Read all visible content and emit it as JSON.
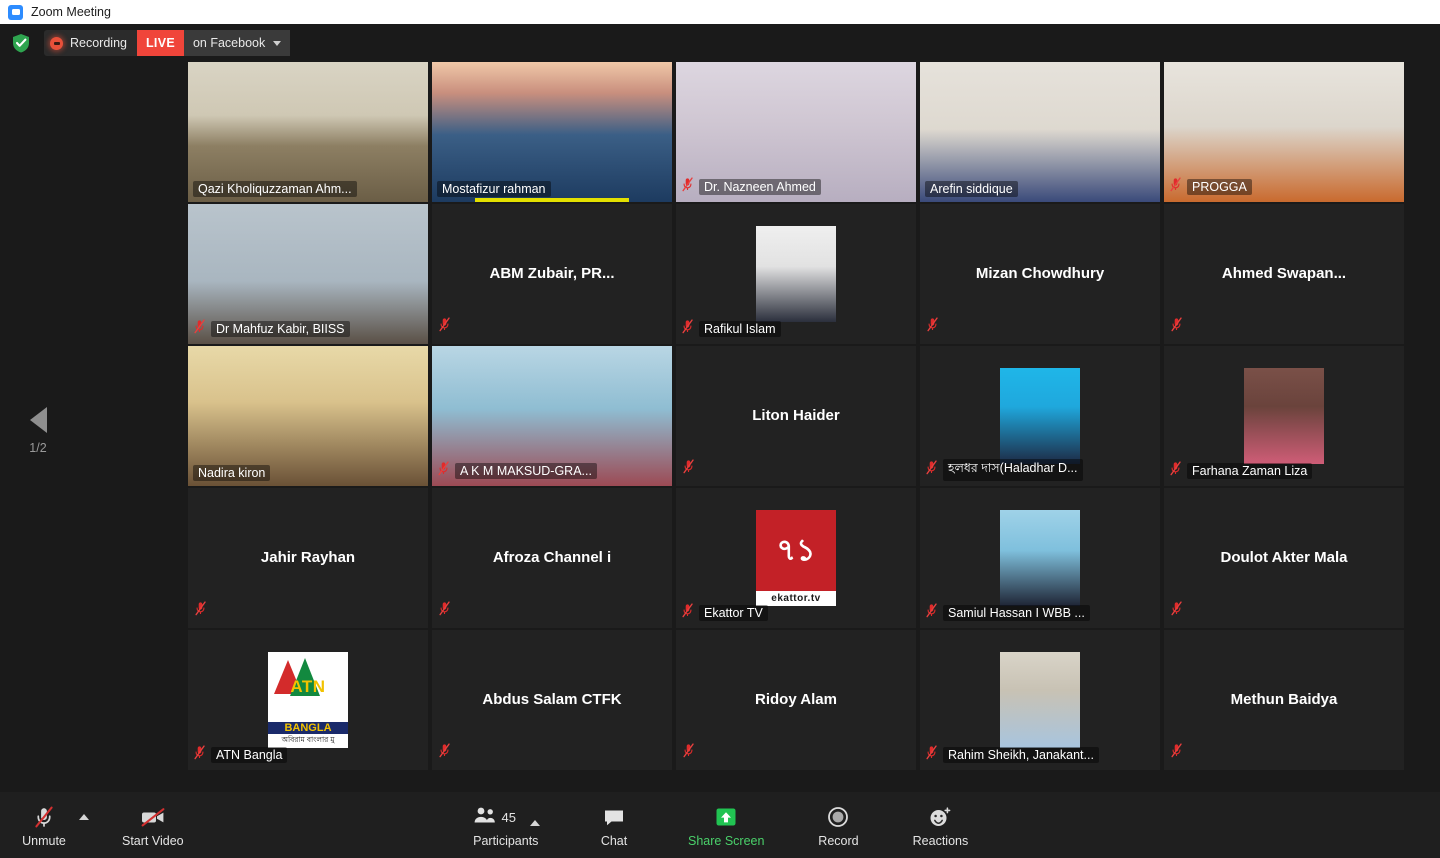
{
  "window": {
    "title": "Zoom Meeting",
    "app_icon": "zoom-video-icon"
  },
  "status_bar": {
    "shield_icon": "encryption-shield-icon",
    "recording_icon": "recording-dot-icon",
    "recording_label": "Recording",
    "live_badge": "LIVE",
    "live_target": "on Facebook",
    "live_dropdown_icon": "chevron-down-icon"
  },
  "page_nav": {
    "prev_icon": "chevron-left-icon",
    "page_indicator": "1/2"
  },
  "colors": {
    "active_speaker": "#e3e000",
    "live_red": "#f0453a",
    "share_green": "#4ad06a",
    "mute_red": "#e02b2b",
    "tile_bg": "#222222"
  },
  "gallery": {
    "rows": [
      [
        {
          "name": "Qazi Kholiquzzaman Ahm...",
          "display": "strip",
          "video": true,
          "muted": false,
          "active": false,
          "speaking": false,
          "media": "video-bookshelf"
        },
        {
          "name": "Mostafizur rahman",
          "display": "strip",
          "video": true,
          "muted": false,
          "active": false,
          "speaking": true,
          "media": "video-sunset"
        },
        {
          "name": "Dr. Nazneen Ahmed",
          "display": "strip",
          "video": true,
          "muted": true,
          "active": false,
          "speaking": false,
          "media": "video-curtain"
        },
        {
          "name": "Arefin siddique",
          "display": "strip",
          "video": true,
          "muted": false,
          "active": true,
          "speaking": false,
          "media": "video-wall-portrait"
        },
        {
          "name": "PROGGA",
          "display": "strip",
          "video": true,
          "muted": true,
          "active": false,
          "speaking": false,
          "media": "video-orange-shirt"
        }
      ],
      [
        {
          "name": "Dr Mahfuz Kabir, BIISS",
          "display": "strip",
          "video": true,
          "muted": true,
          "active": false,
          "speaking": false,
          "media": "video-striped-curtain"
        },
        {
          "name": "ABM  Zubair,  PR...",
          "display": "center",
          "video": false,
          "muted": true,
          "active": false,
          "speaking": false
        },
        {
          "name": "Rafikul Islam",
          "display": "strip",
          "video": false,
          "photo": true,
          "muted": true,
          "active": false,
          "speaking": false,
          "media": "photo-suit-young-man"
        },
        {
          "name": "Mizan Chowdhury",
          "display": "center",
          "video": false,
          "muted": true,
          "active": false,
          "speaking": false
        },
        {
          "name": "Ahmed  Swapan...",
          "display": "center",
          "video": false,
          "muted": true,
          "active": false,
          "speaking": false
        }
      ],
      [
        {
          "name": "Nadira kiron",
          "display": "strip",
          "video": true,
          "muted": false,
          "active": false,
          "speaking": false,
          "media": "video-woman-glasses"
        },
        {
          "name": "A K M MAKSUD-GRA...",
          "display": "strip",
          "video": true,
          "muted": true,
          "active": false,
          "speaking": false,
          "media": "video-blue-curtain-man"
        },
        {
          "name": "Liton Haider",
          "display": "center",
          "video": false,
          "muted": true,
          "active": false,
          "speaking": false
        },
        {
          "name": "হলধর দাস(Haladhar D...",
          "display": "strip",
          "video": false,
          "photo": true,
          "muted": true,
          "active": false,
          "speaking": false,
          "media": "photo-blue-bg-man"
        },
        {
          "name": "Farhana Zaman Liza",
          "display": "strip",
          "video": false,
          "photo": true,
          "muted": true,
          "active": false,
          "speaking": false,
          "media": "photo-woman-pink"
        }
      ],
      [
        {
          "name": "Jahir Rayhan",
          "display": "center",
          "video": false,
          "muted": true,
          "active": false,
          "speaking": false
        },
        {
          "name": "Afroza Channel i",
          "display": "center",
          "video": false,
          "muted": true,
          "active": false,
          "speaking": false
        },
        {
          "name": "Ekattor TV",
          "display": "strip",
          "video": false,
          "photo": true,
          "muted": true,
          "active": false,
          "speaking": false,
          "media": "logo-ekattor-tv"
        },
        {
          "name": "Samiul Hassan  I  WBB ...",
          "display": "strip",
          "video": false,
          "photo": true,
          "muted": true,
          "active": false,
          "speaking": false,
          "media": "photo-man-blue-bg"
        },
        {
          "name": "Doulot Akter Mala",
          "display": "center",
          "video": false,
          "muted": true,
          "active": false,
          "speaking": false
        }
      ],
      [
        {
          "name": "ATN Bangla",
          "display": "strip",
          "video": false,
          "photo": true,
          "muted": true,
          "active": false,
          "speaking": false,
          "media": "logo-atn-bangla"
        },
        {
          "name": "Abdus Salam CTFK",
          "display": "center",
          "video": false,
          "muted": true,
          "active": false,
          "speaking": false
        },
        {
          "name": "Ridoy Alam",
          "display": "center",
          "video": false,
          "muted": true,
          "active": false,
          "speaking": false
        },
        {
          "name": "Rahim Sheikh, Janakant...",
          "display": "strip",
          "video": false,
          "photo": true,
          "muted": true,
          "active": false,
          "speaking": false,
          "media": "photo-man-outdoor"
        },
        {
          "name": "Methun Baidya",
          "display": "center",
          "video": false,
          "muted": true,
          "active": false,
          "speaking": false
        }
      ]
    ],
    "logos": {
      "ekattor": {
        "wordmark": "ekattor.tv",
        "mark": "৭১"
      },
      "atn": {
        "line1": "ATN",
        "line2": "BANGLA",
        "tagline": "অবিরাম বাংলার মু"
      }
    }
  },
  "toolbar": {
    "mute": {
      "label": "Unmute",
      "icon": "microphone-muted-icon",
      "menu_icon": "chevron-up-icon"
    },
    "video": {
      "label": "Start Video",
      "icon": "camera-off-icon"
    },
    "participants": {
      "label": "Participants",
      "count": "45",
      "icon": "people-icon",
      "menu_icon": "chevron-up-icon"
    },
    "chat": {
      "label": "Chat",
      "icon": "chat-bubble-icon"
    },
    "share": {
      "label": "Share Screen",
      "icon": "share-screen-up-arrow-icon"
    },
    "record": {
      "label": "Record",
      "icon": "record-circle-icon"
    },
    "reactions": {
      "label": "Reactions",
      "icon": "smiley-plus-icon"
    }
  }
}
